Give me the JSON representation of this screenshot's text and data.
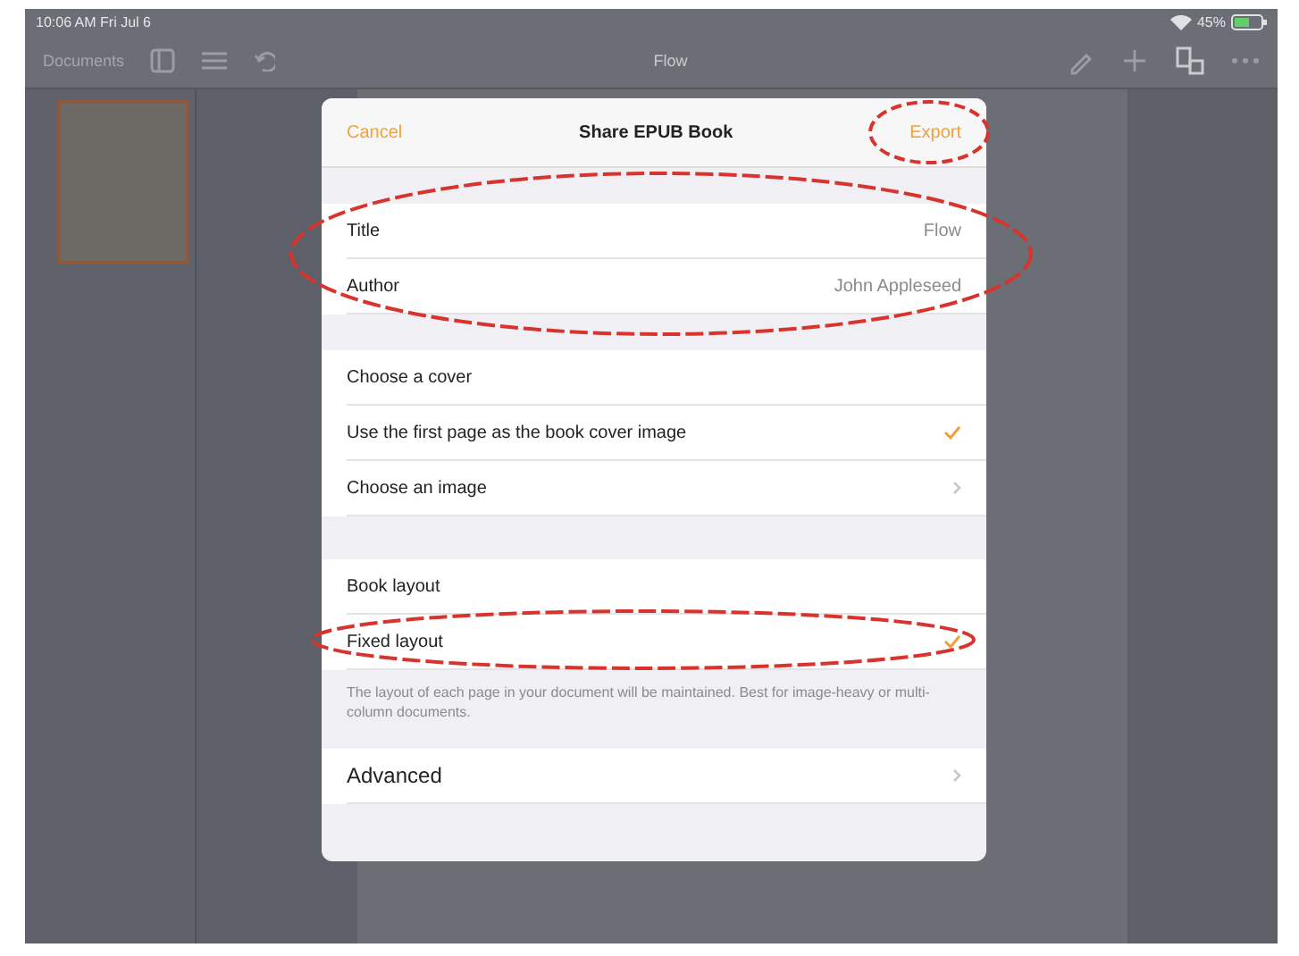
{
  "status_bar": {
    "time": "10:06 AM Fri Jul 6",
    "battery": "45%"
  },
  "toolbar": {
    "back": "Documents",
    "title": "Flow"
  },
  "dialog": {
    "cancel": "Cancel",
    "title": "Share EPUB Book",
    "action": "Export",
    "fields": [
      {
        "label": "Title",
        "value": "Flow"
      },
      {
        "label": "Author",
        "value": "John Appleseed"
      }
    ],
    "cover": {
      "header": "Choose a cover",
      "options": [
        {
          "label": "Use the first page as the book cover image",
          "selected": true
        },
        {
          "label": "Choose an image",
          "selected": false
        }
      ]
    },
    "layout": {
      "header": "Book layout",
      "options": [
        {
          "label": "Fixed layout",
          "selected": true
        }
      ],
      "footer": "The layout of each page in your document will be maintained. Best for image-heavy or multi-column documents."
    },
    "advanced": "Advanced"
  }
}
